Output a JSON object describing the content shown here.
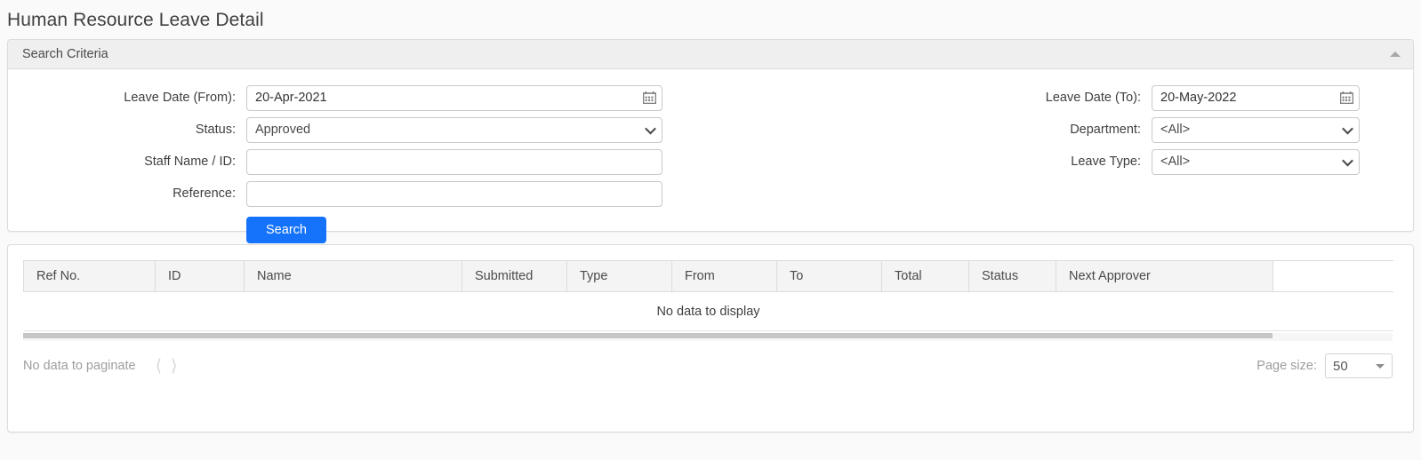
{
  "page": {
    "title": "Human Resource Leave Detail"
  },
  "search_panel": {
    "header": "Search Criteria",
    "collapse_icon": "chevron-up-icon",
    "fields": {
      "leave_date_from": {
        "label": "Leave Date (From):",
        "value": "20-Apr-2021",
        "placeholder": "",
        "icon": "calendar-icon"
      },
      "leave_date_to": {
        "label": "Leave Date (To):",
        "value": "20-May-2022",
        "placeholder": "",
        "icon": "calendar-icon"
      },
      "status": {
        "label": "Status:",
        "value": "Approved",
        "options": [
          "Approved"
        ]
      },
      "department": {
        "label": "Department:",
        "value": "<All>",
        "options": [
          "<All>"
        ]
      },
      "staff_name_id": {
        "label": "Staff Name / ID:",
        "value": "",
        "placeholder": ""
      },
      "leave_type": {
        "label": "Leave Type:",
        "value": "<All>",
        "options": [
          "<All>"
        ]
      },
      "reference": {
        "label": "Reference:",
        "value": "",
        "placeholder": ""
      }
    },
    "search_button": "Search"
  },
  "results_panel": {
    "columns": [
      "Ref No.",
      "ID",
      "Name",
      "Submitted",
      "Type",
      "From",
      "To",
      "Total",
      "Status",
      "Next Approver"
    ],
    "rows": [],
    "empty_message": "No data to display",
    "pagination": {
      "empty_text": "No data to paginate",
      "prev_icon": "chevron-left-icon",
      "next_icon": "chevron-right-icon",
      "page_size_label": "Page size:",
      "page_size_value": "50",
      "page_size_options": [
        "50"
      ]
    }
  },
  "colors": {
    "accent": "#1473fa",
    "panel_header_bg": "#efefef",
    "page_bg": "#fafafa",
    "border": "#dcdcdc"
  }
}
